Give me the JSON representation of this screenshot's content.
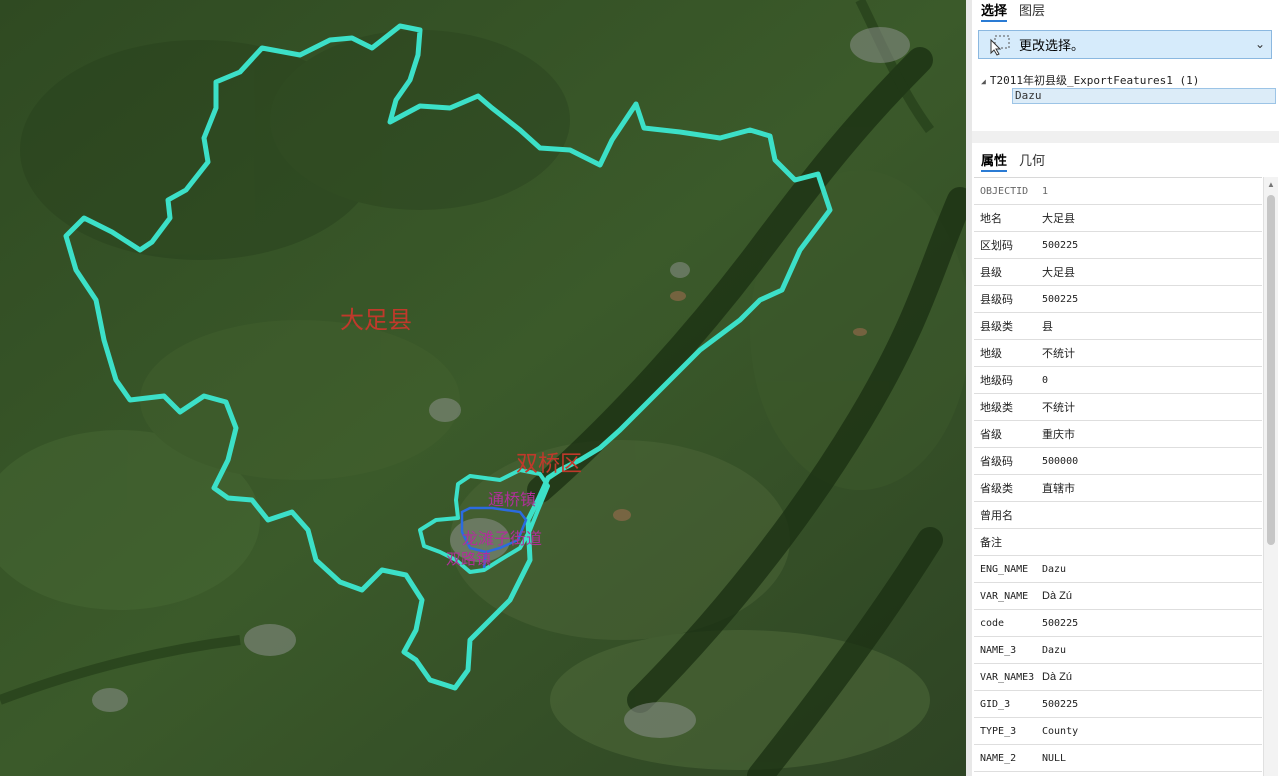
{
  "map": {
    "labels": {
      "county": "大足县",
      "district": "双桥区",
      "town1": "通桥镇",
      "town2": "龙滩子街道",
      "town3": "双路镇"
    },
    "colors": {
      "county_boundary": "#3ce0c8",
      "district_boundary": "#2b6be0",
      "label_red": "#c0392b",
      "label_magenta": "#b0309a"
    }
  },
  "panel": {
    "tabs": [
      "选择",
      "图层"
    ],
    "selection_dropdown": {
      "label": "更改选择。",
      "icon": "select-cursor-icon"
    },
    "tree": {
      "layer": "T2011年初县级_ExportFeatures1 (1)",
      "feature": "Dazu"
    },
    "attr_tabs": [
      "属性",
      "几何"
    ],
    "attributes": [
      {
        "key": "OBJECTID",
        "value": "1"
      },
      {
        "key": "地名",
        "value": "大足县"
      },
      {
        "key": "区划码",
        "value": "500225"
      },
      {
        "key": "县级",
        "value": "大足县"
      },
      {
        "key": "县级码",
        "value": "500225"
      },
      {
        "key": "县级类",
        "value": "县"
      },
      {
        "key": "地级",
        "value": "不统计"
      },
      {
        "key": "地级码",
        "value": "0"
      },
      {
        "key": "地级类",
        "value": "不统计"
      },
      {
        "key": "省级",
        "value": "重庆市"
      },
      {
        "key": "省级码",
        "value": "500000"
      },
      {
        "key": "省级类",
        "value": "直辖市"
      },
      {
        "key": "曾用名",
        "value": ""
      },
      {
        "key": "备注",
        "value": ""
      },
      {
        "key": "ENG_NAME",
        "value": "Dazu"
      },
      {
        "key": "VAR_NAME",
        "value": "Dà Zú"
      },
      {
        "key": "code",
        "value": "500225"
      },
      {
        "key": "NAME_3",
        "value": "Dazu"
      },
      {
        "key": "VAR_NAME3",
        "value": "Dà Zú"
      },
      {
        "key": "GID_3",
        "value": "500225"
      },
      {
        "key": "TYPE_3",
        "value": "County"
      },
      {
        "key": "NAME_2",
        "value": "NULL"
      }
    ]
  }
}
